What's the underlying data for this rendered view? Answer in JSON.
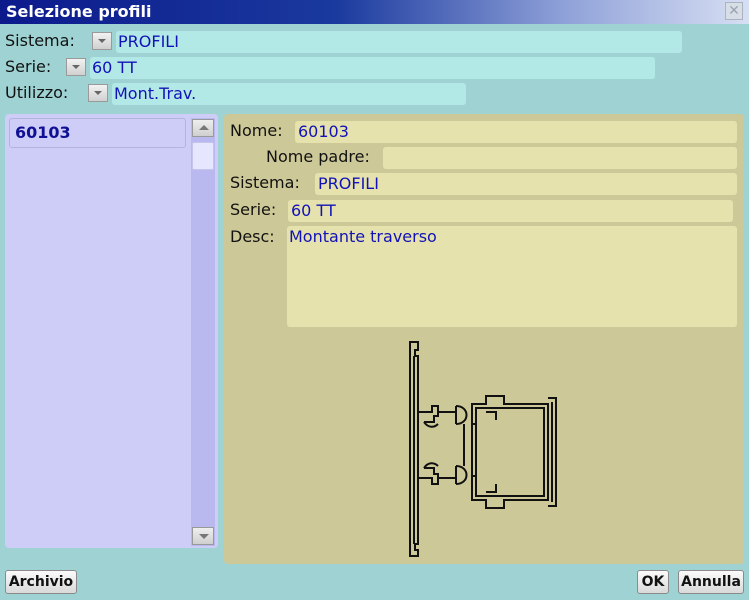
{
  "window": {
    "title": "Selezione profili"
  },
  "filters": [
    {
      "label": "Sistema:",
      "value": "PROFILI"
    },
    {
      "label": "Serie:",
      "value": "60 TT"
    },
    {
      "label": "Utilizzo:",
      "value": "Mont.Trav."
    }
  ],
  "list": {
    "items": [
      "60103"
    ]
  },
  "detail": {
    "nome_label": "Nome:",
    "nome_value": "60103",
    "nome_padre_label": "Nome padre:",
    "nome_padre_value": "",
    "sistema_label": "Sistema:",
    "sistema_value": "PROFILI",
    "serie_label": "Serie:",
    "serie_value": "60 TT",
    "desc_label": "Desc:",
    "desc_value": "Montante traverso"
  },
  "buttons": {
    "archivio": "Archivio",
    "ok": "OK",
    "annulla": "Annulla"
  },
  "icons": {
    "close": "close-icon",
    "dropdown": "chevron-down-icon",
    "scroll_up": "arrow-up-icon",
    "scroll_down": "arrow-down-icon"
  },
  "colors": {
    "titlebar": "#0c1a8c",
    "background": "#9fd3d3",
    "value_text": "#1212b8",
    "list_panel": "#cdcdf8",
    "detail_panel": "#cdc897"
  }
}
